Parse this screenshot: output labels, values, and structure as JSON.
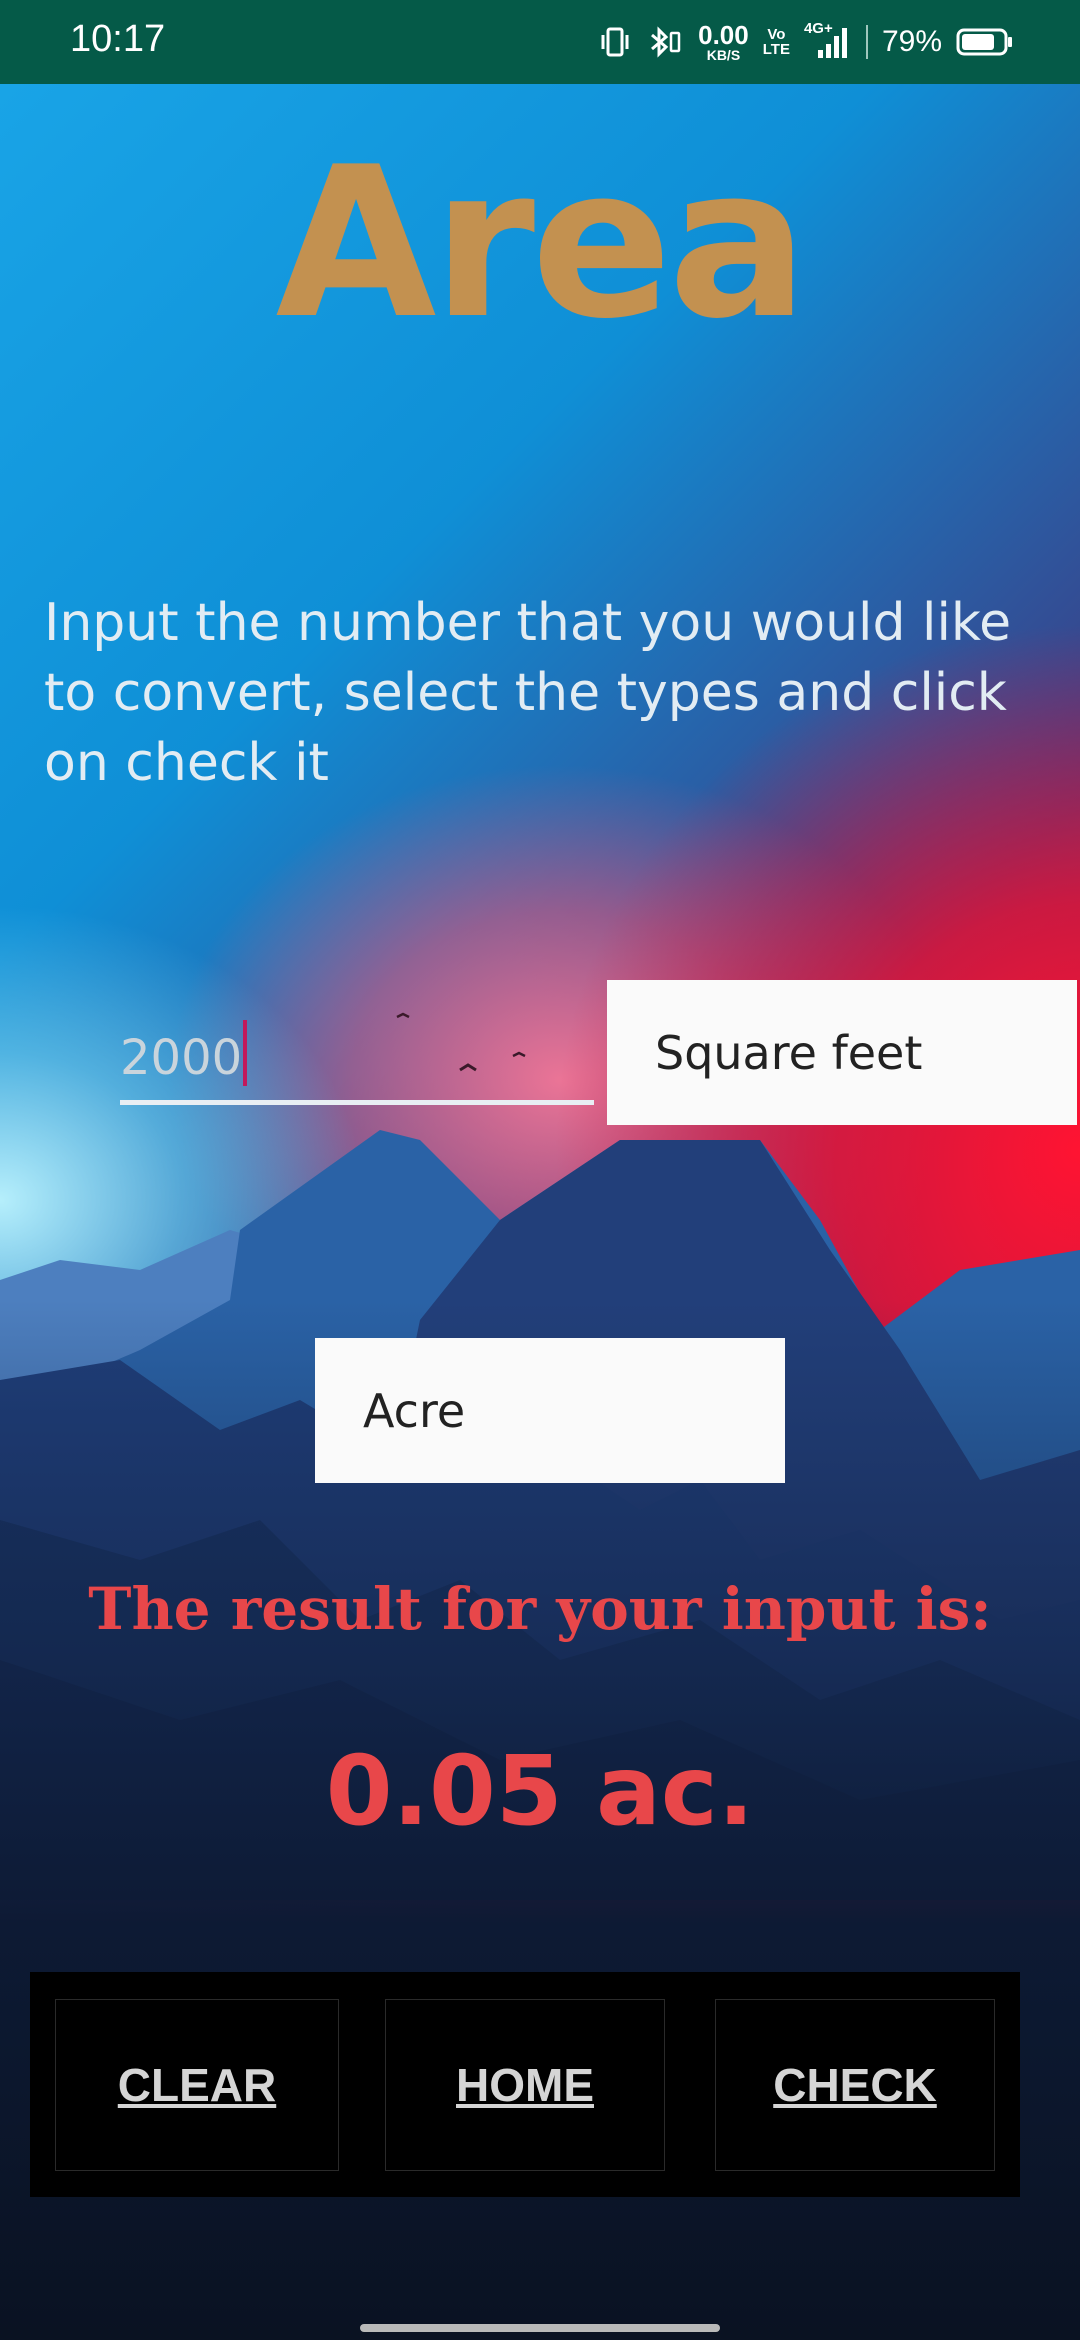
{
  "status_bar": {
    "time": "10:17",
    "net_speed_value": "0.00",
    "net_speed_unit": "KB/S",
    "volte_top": "Vo",
    "volte_bottom": "LTE",
    "network_type": "4G+",
    "battery_percent": "79%",
    "battery_level": 0.79,
    "icons": [
      "vibrate-icon",
      "bluetooth-icon",
      "signal-icon",
      "battery-icon"
    ]
  },
  "page": {
    "title": "Area",
    "instructions": "Input the number that you would like to convert, select the types and click on check it"
  },
  "converter": {
    "input_value": "2000",
    "from_unit": "Square feet",
    "to_unit": "Acre",
    "result_label": "The result for your input is:",
    "result_value": "0.05 ac."
  },
  "buttons": {
    "clear": "CLEAR",
    "home": "HOME",
    "check": "CHECK"
  },
  "colors": {
    "status_bar": "#055a48",
    "title": "#c39150",
    "result": "#e8474a",
    "caret": "#c2185b"
  }
}
